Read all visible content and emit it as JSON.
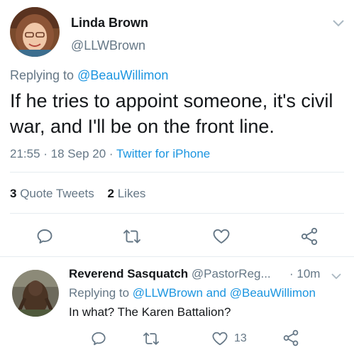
{
  "main_tweet": {
    "author_name": "Linda Brown",
    "author_handle": "@LLWBrown",
    "replying_prefix": "Replying to ",
    "replying_to": "@BeauWillimon",
    "text": "If he tries to appoint someone, it's civil war, and I'll be on the front line.",
    "time": "21:55",
    "sep": " · ",
    "date": "18 Sep 20",
    "source": "Twitter for iPhone",
    "quote_count": "3",
    "quote_label": " Quote Tweets",
    "likes_count": "2",
    "likes_label": " Likes"
  },
  "reply_tweet": {
    "author_name": "Reverend Sasquatch",
    "author_handle": " @PastorReg...",
    "time": "· 10m",
    "replying_prefix": "Replying to ",
    "replying_to_1": "@LLWBrown",
    "and": " and ",
    "replying_to_2": "@BeauWillimon",
    "text": "In what? The Karen Battalion?",
    "like_count": "13"
  },
  "colors": {
    "link": "#1b95e0",
    "secondary": "#657786",
    "icon": "#657786",
    "divider": "#e6ecf0"
  },
  "icons": [
    "chevron-down-icon",
    "reply-icon",
    "retweet-icon",
    "like-icon",
    "share-icon"
  ]
}
